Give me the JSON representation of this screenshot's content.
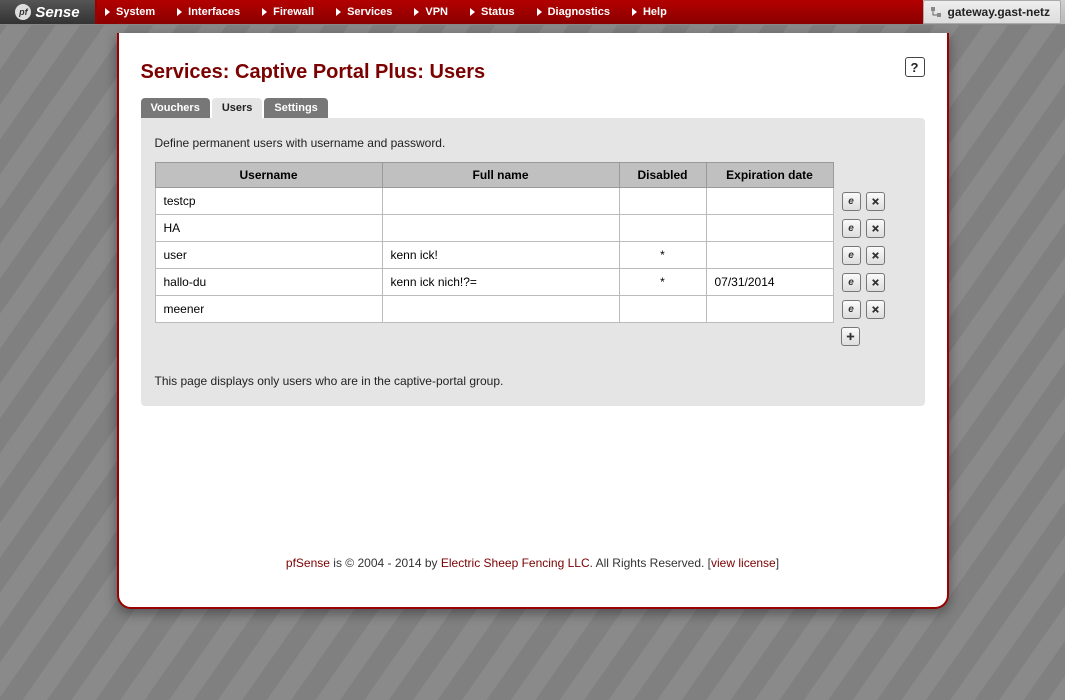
{
  "logo_text": "Sense",
  "menu": [
    "System",
    "Interfaces",
    "Firewall",
    "Services",
    "VPN",
    "Status",
    "Diagnostics",
    "Help"
  ],
  "hostname": "gateway.gast-netz",
  "page_title": "Services: Captive Portal Plus: Users",
  "tabs": {
    "vouchers": "Vouchers",
    "users": "Users",
    "settings": "Settings"
  },
  "active_tab": "users",
  "panel_desc": "Define permanent users with username and password.",
  "columns": {
    "username": "Username",
    "fullname": "Full name",
    "disabled": "Disabled",
    "expiration": "Expiration date"
  },
  "rows": [
    {
      "username": "testcp",
      "fullname": "",
      "disabled": "",
      "expiration": ""
    },
    {
      "username": "HA",
      "fullname": "",
      "disabled": "",
      "expiration": ""
    },
    {
      "username": "user",
      "fullname": "kenn ick!",
      "disabled": "*",
      "expiration": ""
    },
    {
      "username": "hallo-du",
      "fullname": "kenn ick nich!?=",
      "disabled": "*",
      "expiration": "07/31/2014"
    },
    {
      "username": "meener",
      "fullname": "",
      "disabled": "",
      "expiration": ""
    }
  ],
  "note": "This page displays only users who are in the captive-portal group.",
  "footer": {
    "brand": "pfSense",
    "text1": " is © 2004 - 2014 by ",
    "company": "Electric Sheep Fencing LLC",
    "text2": ". All Rights Reserved. [",
    "license": "view license",
    "text3": "]"
  },
  "help_glyph": "?"
}
